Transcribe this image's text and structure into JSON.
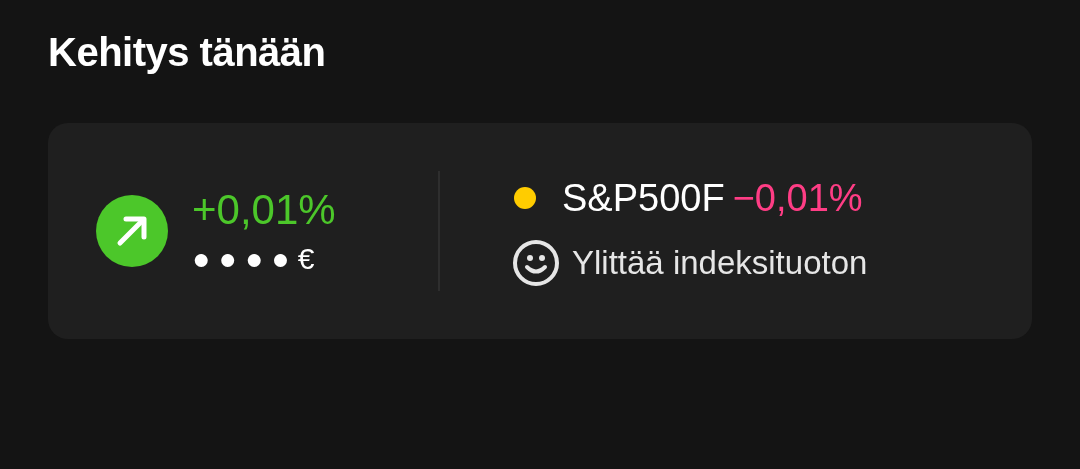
{
  "title": "Kehitys tänään",
  "summary": {
    "kind": "up",
    "change": "+0,01%",
    "value": "● ● ● ● €"
  },
  "benchmark": {
    "name": "S&P500F",
    "kind": "down",
    "change": "−0,01%",
    "note": "Ylittää indeksituoton"
  }
}
